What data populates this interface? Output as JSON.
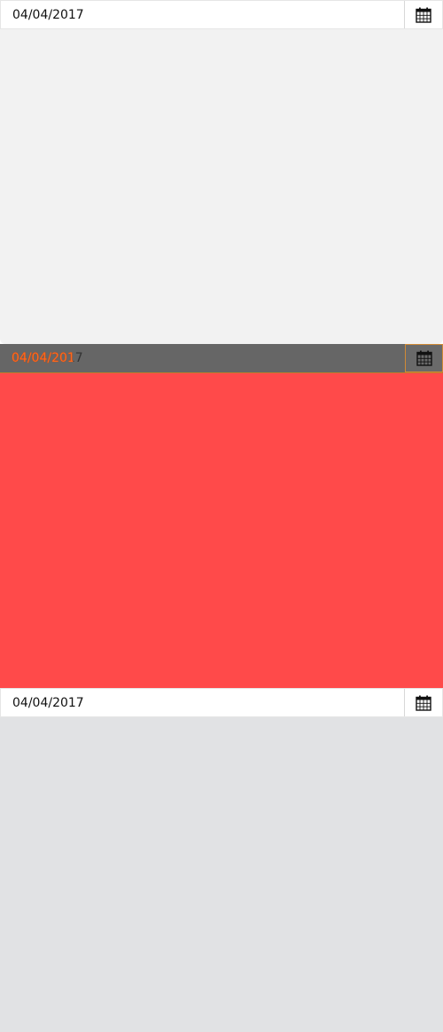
{
  "pickers": [
    {
      "value": "04/04/2017",
      "icon": "calendar-icon"
    },
    {
      "value": "04/04/2017",
      "icon": "calendar-icon"
    },
    {
      "value": "04/04/2017",
      "icon": "calendar-icon"
    }
  ],
  "colors": {
    "panel_light": "#f2f2f2",
    "panel_red": "#ff4a4a",
    "panel_grey": "#e1e2e4",
    "field_dark": "#666666",
    "accent_orange": "#d08a35"
  }
}
